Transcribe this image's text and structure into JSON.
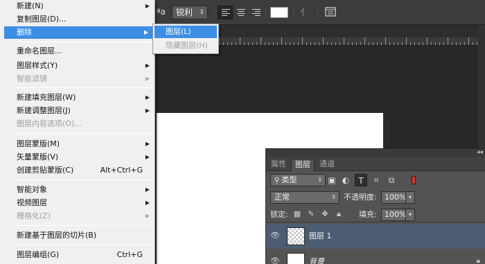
{
  "toolbar": {
    "aa_label": "ªa",
    "aa_value": "锐利",
    "icons": [
      "align-left-icon",
      "align-center-icon",
      "align-right-icon",
      "warp-text-icon",
      "panels-icon"
    ],
    "text_color": "#ffffff"
  },
  "menu": {
    "items": [
      {
        "label": "新建(N)",
        "submenu": true,
        "disabled": false
      },
      {
        "label": "复制图层(D)...",
        "submenu": false,
        "disabled": false
      },
      {
        "label": "删除",
        "submenu": true,
        "disabled": false,
        "highlighted": true
      },
      {
        "label": "重命名图层...",
        "submenu": false,
        "disabled": false
      },
      {
        "label": "图层样式(Y)",
        "submenu": true,
        "disabled": false
      },
      {
        "label": "智能滤镜",
        "submenu": true,
        "disabled": true
      },
      {
        "label": "新建填充图层(W)",
        "submenu": true,
        "disabled": false
      },
      {
        "label": "新建调整图层(J)",
        "submenu": true,
        "disabled": false
      },
      {
        "label": "图层内容选项(O)...",
        "submenu": false,
        "disabled": true
      },
      {
        "label": "图层蒙版(M)",
        "submenu": true,
        "disabled": false
      },
      {
        "label": "矢量蒙版(V)",
        "submenu": true,
        "disabled": false
      },
      {
        "label": "创建剪贴蒙版(C)",
        "shortcut": "Alt+Ctrl+G",
        "submenu": false,
        "disabled": false
      },
      {
        "label": "智能对象",
        "submenu": true,
        "disabled": false
      },
      {
        "label": "视频图层",
        "submenu": true,
        "disabled": false
      },
      {
        "label": "栅格化(Z)",
        "submenu": true,
        "disabled": true
      },
      {
        "label": "新建基于图层的切片(B)",
        "submenu": false,
        "disabled": false
      },
      {
        "label": "图层编组(G)",
        "shortcut": "Ctrl+G",
        "submenu": false,
        "disabled": false
      }
    ],
    "accent_color": "#3d8ee4"
  },
  "submenu": {
    "items": [
      {
        "label": "图层(L)",
        "highlighted": true,
        "disabled": false
      },
      {
        "label": "隐藏图层(H)",
        "highlighted": false,
        "disabled": true
      }
    ]
  },
  "layers_panel": {
    "tabs": [
      {
        "label": "属性",
        "active": false
      },
      {
        "label": "图层",
        "active": true
      },
      {
        "label": "通道",
        "active": false
      }
    ],
    "filter": {
      "value": "类型"
    },
    "blend_mode": "正常",
    "opacity_label": "不透明度:",
    "opacity_value": "100%",
    "lock_label": "锁定:",
    "fill_label": "填充:",
    "fill_value": "100%",
    "layers": [
      {
        "name": "图层 1",
        "selected": true,
        "thumbnail": "transparent"
      },
      {
        "name": "背景",
        "selected": false,
        "thumbnail": "white",
        "locked": true
      }
    ]
  }
}
